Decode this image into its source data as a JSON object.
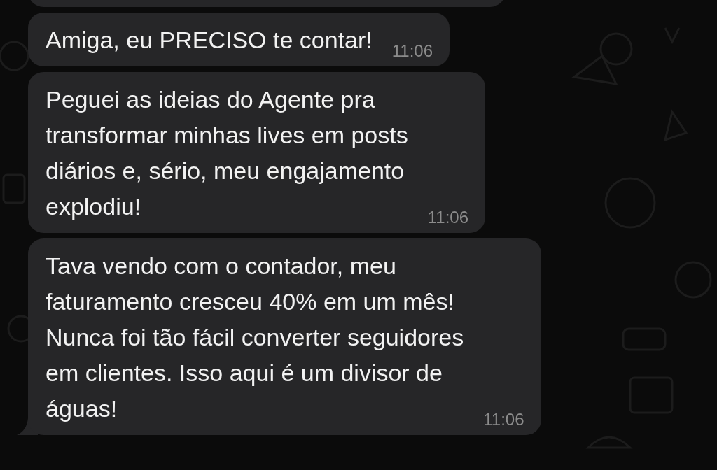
{
  "messages": [
    {
      "kind": "partial",
      "tail": false
    },
    {
      "kind": "text",
      "text": "Amiga, eu PRECISO te contar!",
      "time": "11:06",
      "tail": false
    },
    {
      "kind": "text",
      "text": "Peguei as ideias do Agente pra\ntransformar minhas lives em posts\ndiários e, sério, meu engajamento\nexplodiu!",
      "time": "11:06",
      "tail": false
    },
    {
      "kind": "text",
      "text": "Tava vendo com o contador, meu\nfaturamento cresceu 40% em um mês!\nNunca foi tão fácil converter seguidores\nem clientes. Isso aqui é um divisor de\náguas!",
      "time": "11:06",
      "tail": true
    }
  ]
}
